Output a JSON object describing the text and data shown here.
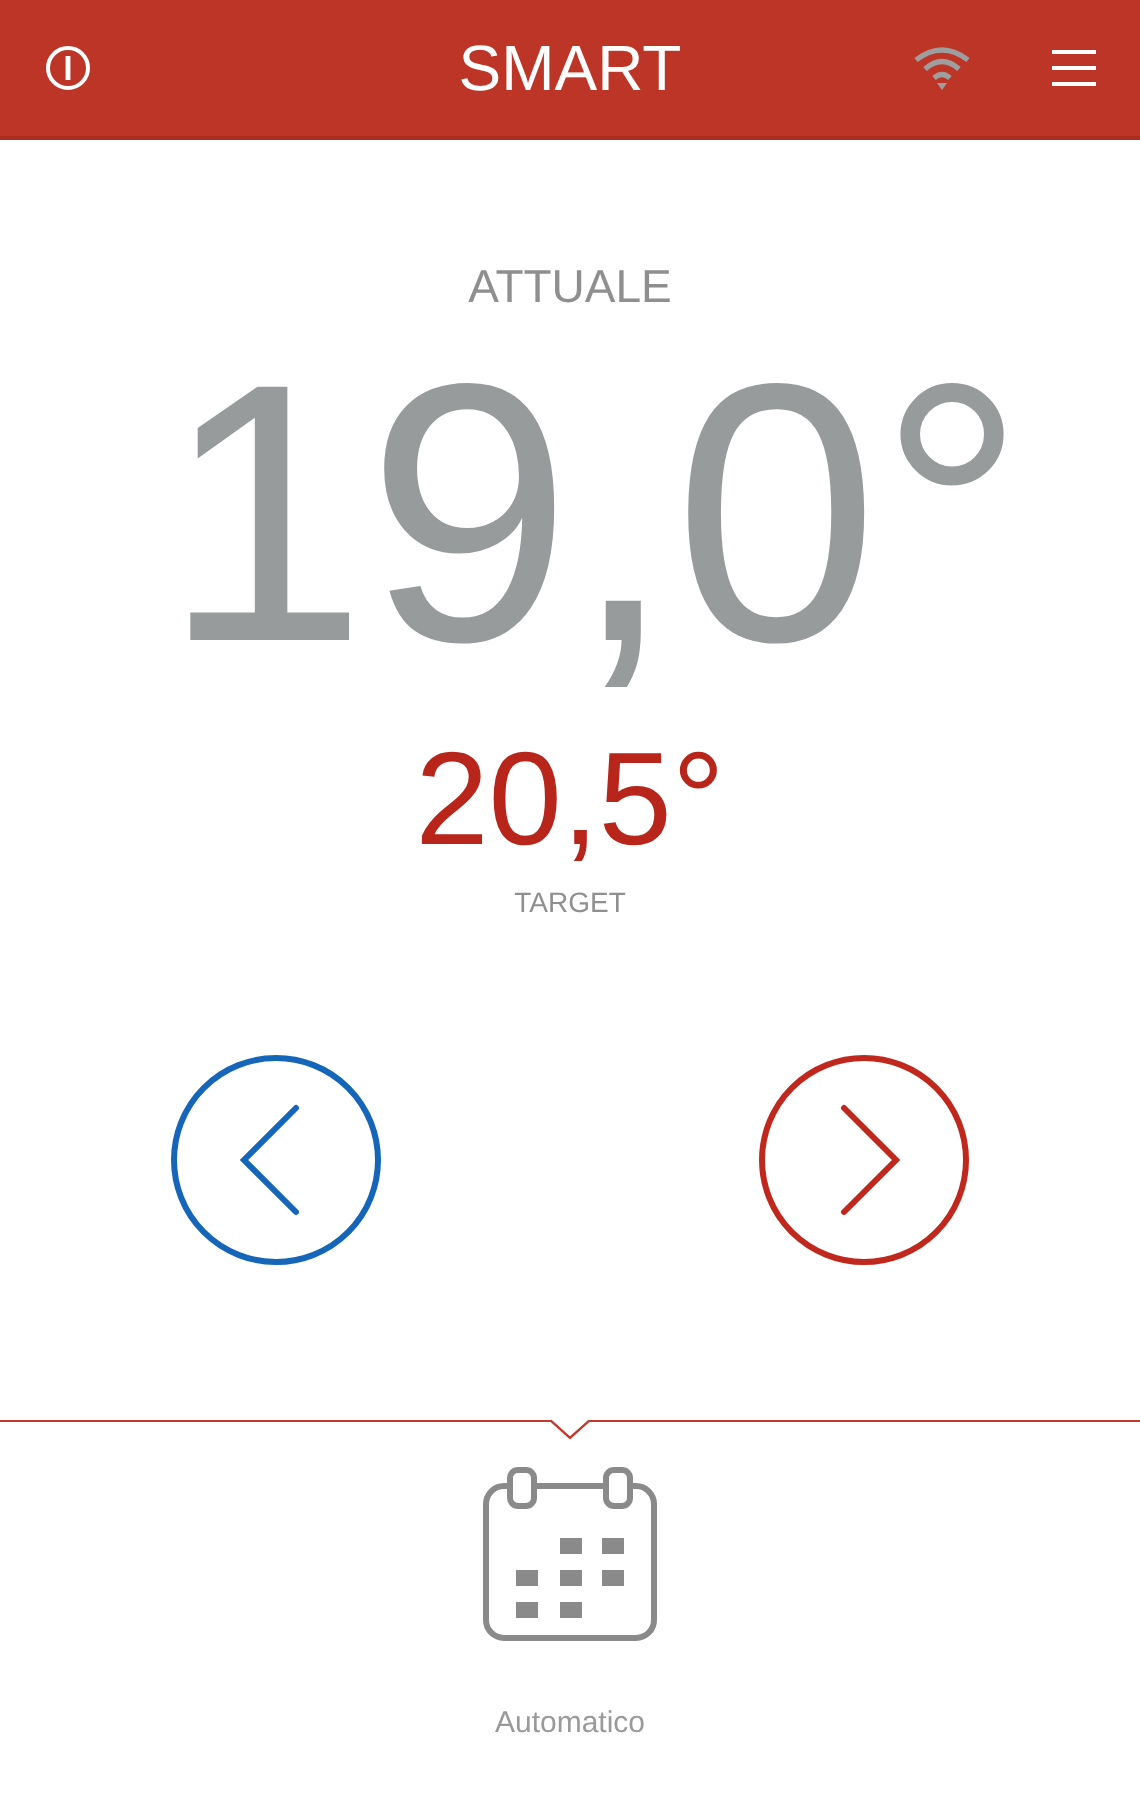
{
  "header": {
    "title": "SMART"
  },
  "current": {
    "label": "ATTUALE",
    "value": "19,0°"
  },
  "target": {
    "value": "20,5°",
    "label": "TARGET"
  },
  "buttons": [
    {
      "kind": "decrease",
      "color": "#1565b8"
    },
    {
      "kind": "increase",
      "color": "#c0281e"
    }
  ],
  "mode": {
    "label": "Automatico"
  }
}
